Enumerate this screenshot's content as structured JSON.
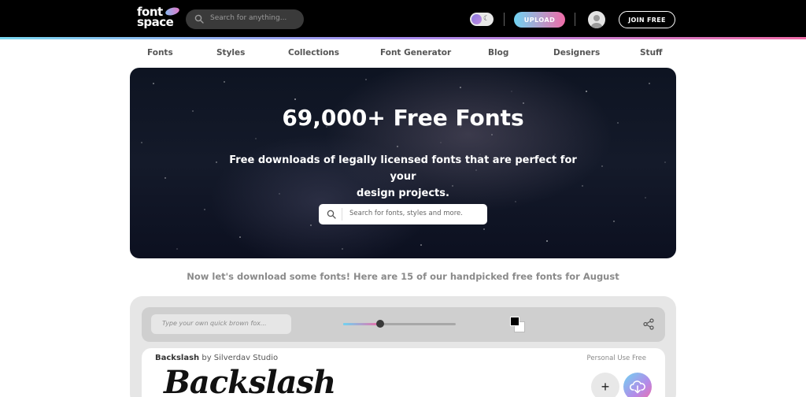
{
  "header": {
    "logo_line1": "font",
    "logo_line2": "space",
    "search_placeholder": "Search for anything...",
    "upload_label": "UPLOAD",
    "join_label": "JOIN FREE"
  },
  "nav": {
    "items": [
      "Fonts",
      "Styles",
      "Collections",
      "Font Generator",
      "Blog",
      "Designers",
      "Stuff"
    ]
  },
  "hero": {
    "title": "69,000+ Free Fonts",
    "subtitle_line1": "Free downloads of legally licensed fonts that are perfect for your",
    "subtitle_line2": "design projects.",
    "search_placeholder": "Search for fonts, styles and more."
  },
  "tagline": "Now let's download some fonts! Here are 15 of our handpicked free fonts for August",
  "font_card": {
    "type_placeholder": "Type your own quick brown fox...",
    "size_slider_value": 0.33,
    "font_name": "Backslash",
    "by_text": "by Silverdav Studio",
    "license": "Personal Use Free",
    "sample_text": "Backslash",
    "add_symbol": "+"
  },
  "colors": {
    "header_bg": "#000000",
    "accent_gradient_start": "#6fd3f2",
    "accent_gradient_end": "#f06ca8",
    "tagline": "#8a8a8a"
  }
}
